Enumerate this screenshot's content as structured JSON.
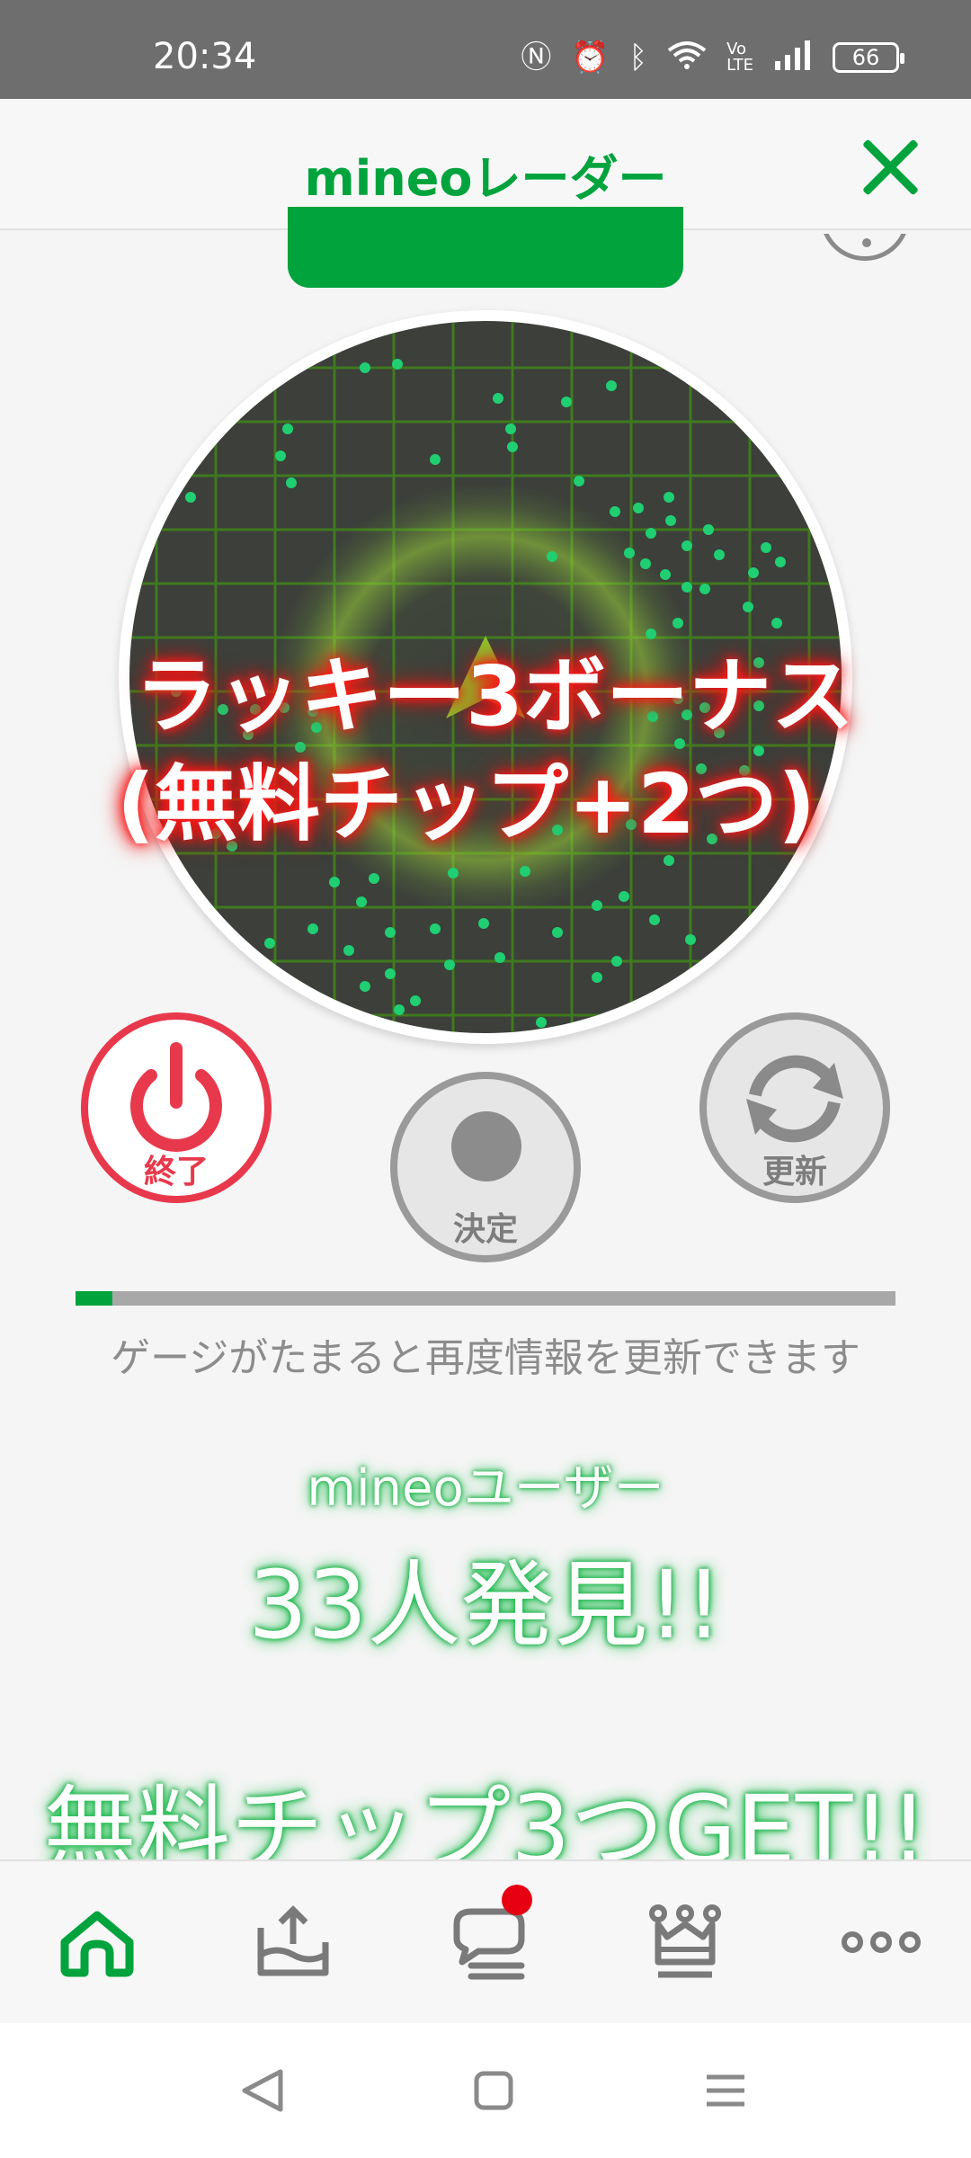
{
  "status_bar": {
    "time": "20:34",
    "battery": "66",
    "icons": [
      "nfc-icon",
      "alarm-icon",
      "bluetooth-icon",
      "wifi-icon",
      "volte-icon",
      "signal-icon",
      "battery-icon"
    ]
  },
  "header": {
    "title": "mineoレーダー",
    "close_icon": "close-icon"
  },
  "radar": {
    "bonus_line1": "ラッキー3ボーナス",
    "bonus_line2": "(無料チップ+2つ)"
  },
  "buttons": {
    "end_label": "終了",
    "decide_label": "決定",
    "update_label": "更新"
  },
  "gauge": {
    "progress": 0.045,
    "text": "ゲージがたまると再度情報を更新できます"
  },
  "results": {
    "users_label": "mineoユーザー",
    "found_text": "33人発見!!",
    "chips_text": "無料チップ3つGET!!"
  },
  "tabs": [
    {
      "icon": "home-icon",
      "active": true
    },
    {
      "icon": "upload-tray-icon",
      "active": false
    },
    {
      "icon": "chat-icon",
      "active": false,
      "badge": true
    },
    {
      "icon": "crown-icon",
      "active": false
    },
    {
      "icon": "more-icon",
      "active": false
    }
  ],
  "colors": {
    "brand_green": "#00a33c",
    "end_red": "#e8394c",
    "badge_red": "#e60012"
  }
}
